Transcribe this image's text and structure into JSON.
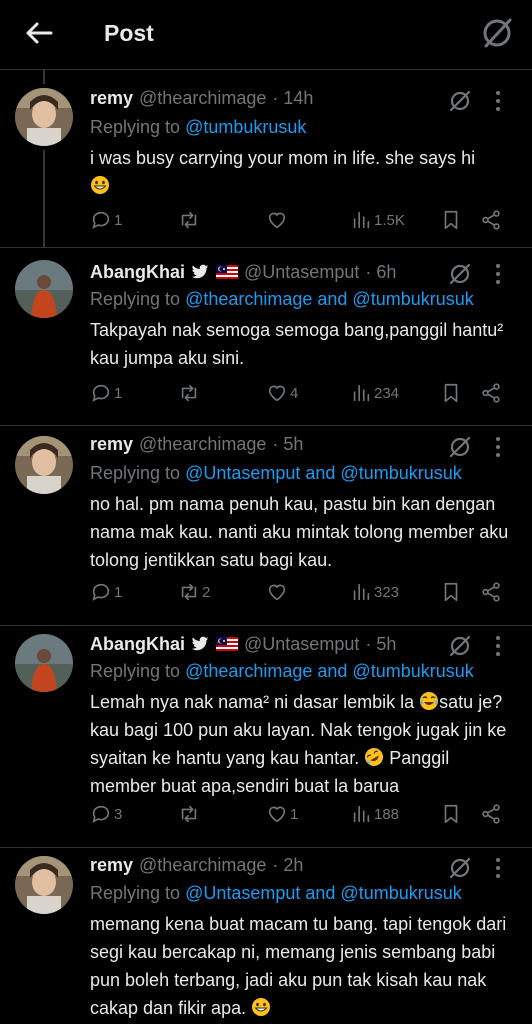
{
  "header": {
    "title": "Post"
  },
  "tweets": [
    {
      "name": "remy",
      "handle": "@thearchimage",
      "time": "· 14h",
      "replying_prefix": "Replying to ",
      "replying_to": "@tumbukrusuk",
      "text": "i was busy carrying your mom in life. she says hi",
      "emoji": "grin",
      "replies": "1",
      "retweets": "",
      "likes": "",
      "views": "1.5K"
    },
    {
      "name": "AbangKhai",
      "handle": "@Untasemput",
      "time": "· 6h",
      "replying_prefix": "Replying to ",
      "replying_to": "@thearchimage and @tumbukrusuk",
      "text": "Takpayah nak semoga semoga bang,panggil hantu² kau jumpa aku sini.",
      "replies": "1",
      "retweets": "",
      "likes": "4",
      "views": "234"
    },
    {
      "name": "remy",
      "handle": "@thearchimage",
      "time": "· 5h",
      "replying_prefix": "Replying to ",
      "replying_to": "@Untasemput and @tumbukrusuk",
      "text": "no hal. pm nama penuh kau,  pastu bin kan dengan nama mak kau. nanti aku mintak tolong member aku tolong jentikkan satu bagi kau.",
      "replies": "1",
      "retweets": "2",
      "likes": "",
      "views": "323"
    },
    {
      "name": "AbangKhai",
      "handle": "@Untasemput",
      "time": "· 5h",
      "replying_prefix": "Replying to ",
      "replying_to": "@thearchimage and @tumbukrusuk",
      "text_a": "Lemah nya nak nama² ni dasar lembik la ",
      "text_b": "satu je?kau bagi 100 pun aku layan. Nak tengok jugak jin ke syaitan ke hantu yang kau hantar. ",
      "text_c": " Panggil member buat apa,sendiri buat la barua",
      "replies": "3",
      "retweets": "",
      "likes": "1",
      "views": "188"
    },
    {
      "name": "remy",
      "handle": "@thearchimage",
      "time": "· 2h",
      "replying_prefix": "Replying to ",
      "replying_to": "@Untasemput and @tumbukrusuk",
      "text": "memang kena buat macam tu bang. tapi tengok dari segi kau bercakap ni, memang jenis sembang babi pun boleh terbang, jadi aku pun tak kisah kau nak cakap dan fikir apa.",
      "replies": "",
      "retweets": "",
      "likes": "",
      "views": ""
    }
  ],
  "colors": {
    "background": "#000000",
    "text": "#e7e9ea",
    "muted": "#71767b",
    "link": "#1d9bf0",
    "divider": "#2f3336"
  }
}
